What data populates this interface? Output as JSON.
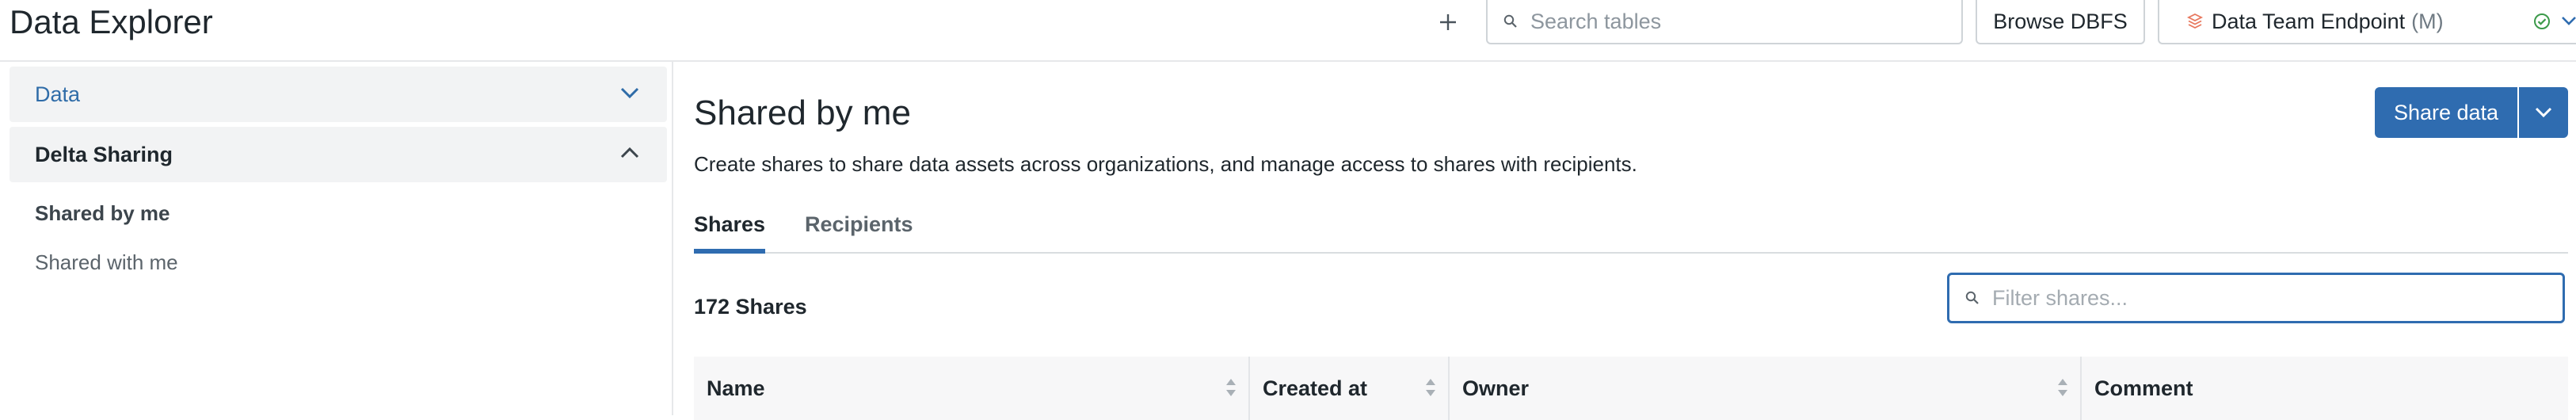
{
  "header": {
    "app_title": "Data Explorer",
    "search_placeholder": "Search tables",
    "browse_label": "Browse DBFS",
    "endpoint": {
      "name": "Data Team Endpoint",
      "size": "(M)",
      "status": "running"
    }
  },
  "sidebar": {
    "sections": [
      {
        "label": "Data",
        "expanded": false
      },
      {
        "label": "Delta Sharing",
        "expanded": true
      }
    ],
    "links": [
      "Shared by me",
      "Shared with me"
    ]
  },
  "main": {
    "title": "Shared by me",
    "description": "Create shares to share data assets across organizations, and manage access to shares with recipients.",
    "share_button": "Share data",
    "tabs": [
      "Shares",
      "Recipients"
    ],
    "active_tab": "Shares",
    "count_label": "172 Shares",
    "filter_placeholder": "Filter shares...",
    "columns": [
      "Name",
      "Created at",
      "Owner",
      "Comment"
    ]
  },
  "colors": {
    "accent": "#2f6cb0",
    "link": "#2f6ca8",
    "status_ok": "#3c9a4a",
    "endpoint_icon": "#e8785e"
  },
  "icons": {
    "add": "plus-icon",
    "search": "search-icon",
    "endpoint": "endpoint-stack-icon",
    "status": "check-circle-icon",
    "chevron": "chevron-down-icon",
    "sort": "sort-icon"
  }
}
